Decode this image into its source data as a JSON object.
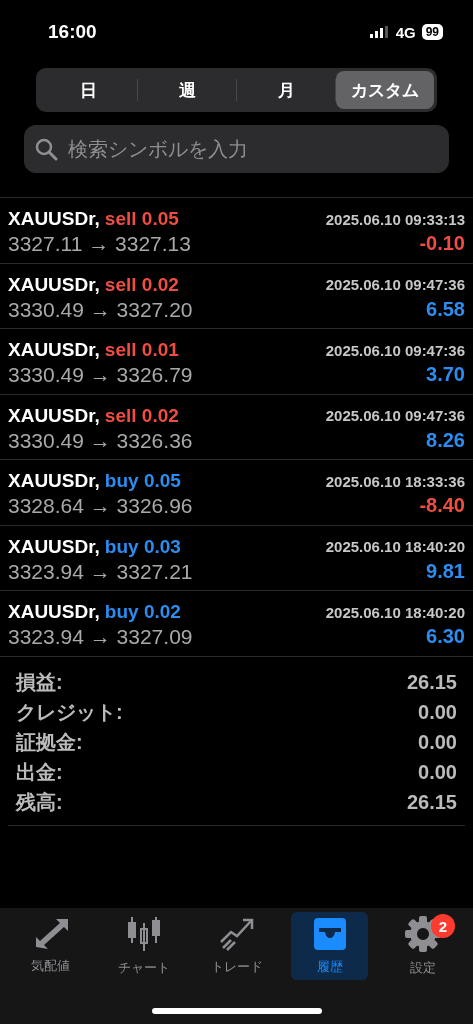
{
  "status_bar": {
    "time": "16:00",
    "network": "4G",
    "battery": "99"
  },
  "period_tabs": [
    {
      "label": "日",
      "selected": false
    },
    {
      "label": "週",
      "selected": false
    },
    {
      "label": "月",
      "selected": false
    },
    {
      "label": "カスタム",
      "selected": true
    }
  ],
  "search": {
    "placeholder": "検索シンボルを入力"
  },
  "trades": [
    {
      "symbol": "XAUUSDr,",
      "order": "sell 0.05",
      "kind": "sell",
      "time": "2025.06.10 09:33:13",
      "prices": "3327.11 → 3327.13",
      "profit": "-0.10",
      "negative": true
    },
    {
      "symbol": "XAUUSDr,",
      "order": "sell 0.02",
      "kind": "sell",
      "time": "2025.06.10 09:47:36",
      "prices": "3330.49 → 3327.20",
      "profit": "6.58",
      "negative": false
    },
    {
      "symbol": "XAUUSDr,",
      "order": "sell 0.01",
      "kind": "sell",
      "time": "2025.06.10 09:47:36",
      "prices": "3330.49 → 3326.79",
      "profit": "3.70",
      "negative": false
    },
    {
      "symbol": "XAUUSDr,",
      "order": "sell 0.02",
      "kind": "sell",
      "time": "2025.06.10 09:47:36",
      "prices": "3330.49 → 3326.36",
      "profit": "8.26",
      "negative": false
    },
    {
      "symbol": "XAUUSDr,",
      "order": "buy 0.05",
      "kind": "buy",
      "time": "2025.06.10 18:33:36",
      "prices": "3328.64 → 3326.96",
      "profit": "-8.40",
      "negative": true
    },
    {
      "symbol": "XAUUSDr,",
      "order": "buy 0.03",
      "kind": "buy",
      "time": "2025.06.10 18:40:20",
      "prices": "3323.94 → 3327.21",
      "profit": "9.81",
      "negative": false
    },
    {
      "symbol": "XAUUSDr,",
      "order": "buy 0.02",
      "kind": "buy",
      "time": "2025.06.10 18:40:20",
      "prices": "3323.94 → 3327.09",
      "profit": "6.30",
      "negative": false
    }
  ],
  "summary": [
    {
      "label": "損益:",
      "value": "26.15"
    },
    {
      "label": "クレジット:",
      "value": "0.00"
    },
    {
      "label": "証拠金:",
      "value": "0.00"
    },
    {
      "label": "出金:",
      "value": "0.00"
    },
    {
      "label": "残高:",
      "value": "26.15"
    }
  ],
  "bottom_tabs": [
    {
      "label": "気配値",
      "kind": "quotes",
      "selected": false
    },
    {
      "label": "チャート",
      "kind": "chart",
      "selected": false
    },
    {
      "label": "トレード",
      "kind": "trade",
      "selected": false
    },
    {
      "label": "履歴",
      "kind": "history",
      "selected": true
    },
    {
      "label": "設定",
      "kind": "settings",
      "selected": false,
      "badge": "2"
    }
  ]
}
